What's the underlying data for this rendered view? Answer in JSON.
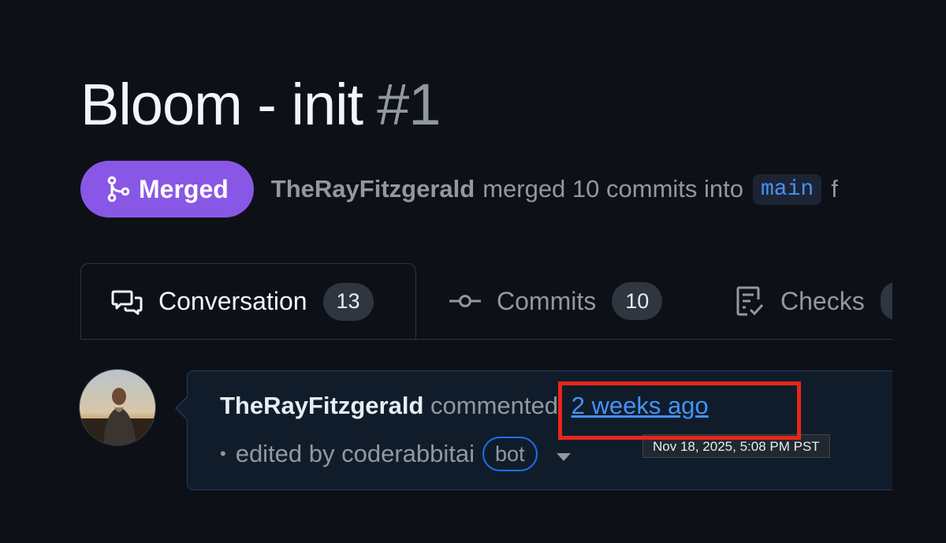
{
  "pr": {
    "title": "Bloom - init",
    "number": "#1",
    "status_label": "Merged",
    "author": "TheRayFitzgerald",
    "merge_text": "merged 10 commits into",
    "base_branch": "main",
    "trailing_text": "f"
  },
  "tabs": [
    {
      "label": "Conversation",
      "count": "13",
      "icon": "comment-discussion-icon",
      "active": true
    },
    {
      "label": "Commits",
      "count": "10",
      "icon": "git-commit-icon"
    },
    {
      "label": "Checks",
      "count": "",
      "icon": "checklist-icon"
    }
  ],
  "comment": {
    "author": "TheRayFitzgerald",
    "action": "commented",
    "time_ago": "2 weeks ago",
    "edited_prefix": "•",
    "edited_text": "edited by coderabbitai",
    "bot_label": "bot",
    "tooltip": "Nov 18, 2025, 5:08 PM PST"
  },
  "colors": {
    "background": "#0d1117",
    "merged": "#8957e5",
    "link": "#4493f8",
    "highlight": "#e8261a"
  }
}
